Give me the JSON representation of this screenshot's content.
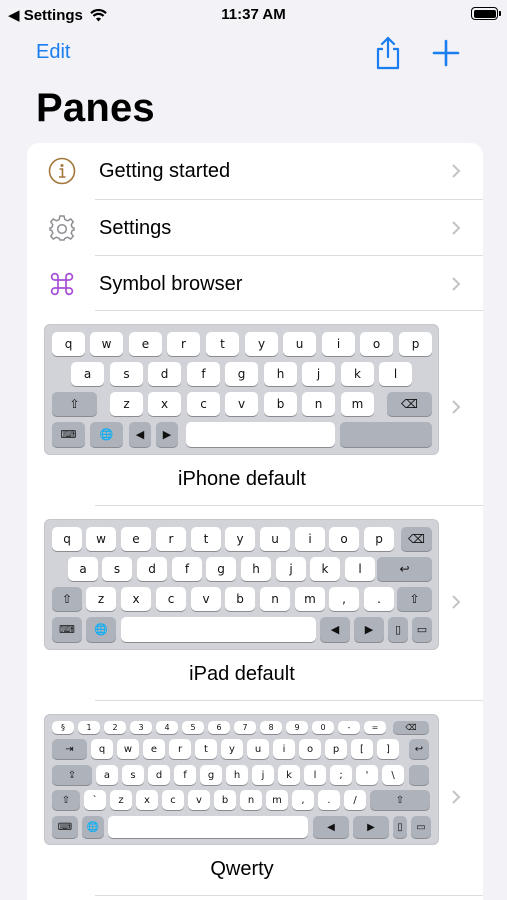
{
  "status": {
    "back_label": "◀ Settings",
    "time": "11:37 AM"
  },
  "nav": {
    "edit": "Edit",
    "share_icon": "share-icon",
    "add_icon": "plus-icon",
    "accent": "#1a7ef0"
  },
  "title": "Panes",
  "menu": [
    {
      "label": "Getting started",
      "icon": "info-icon",
      "color": "#a3773a"
    },
    {
      "label": "Settings",
      "icon": "gear-icon",
      "color": "#8e8e93"
    },
    {
      "label": "Symbol browser",
      "icon": "command-icon",
      "color": "#a64fd6"
    }
  ],
  "keyboards": [
    {
      "name": "iPhone default",
      "rows": [
        [
          "q",
          "w",
          "e",
          "r",
          "t",
          "y",
          "u",
          "i",
          "o",
          "p"
        ],
        [
          "a",
          "s",
          "d",
          "f",
          "g",
          "h",
          "j",
          "k",
          "l"
        ],
        [
          "⇧",
          "z",
          "x",
          "c",
          "v",
          "b",
          "n",
          "m",
          "⌫"
        ],
        [
          "⌨",
          "🌐",
          "◀",
          "▶",
          "",
          ""
        ]
      ]
    },
    {
      "name": "iPad default",
      "rows": [
        [
          "q",
          "w",
          "e",
          "r",
          "t",
          "y",
          "u",
          "i",
          "o",
          "p",
          "⌫"
        ],
        [
          "a",
          "s",
          "d",
          "f",
          "g",
          "h",
          "j",
          "k",
          "l",
          "↩"
        ],
        [
          "⇧",
          "z",
          "x",
          "c",
          "v",
          "b",
          "n",
          "m",
          ",",
          ".",
          "⇧"
        ],
        [
          "⌨",
          "🌐",
          "",
          "◀",
          "▶",
          "▯",
          "▭"
        ]
      ]
    },
    {
      "name": "Qwerty",
      "rows": [
        [
          "§",
          "1",
          "2",
          "3",
          "4",
          "5",
          "6",
          "7",
          "8",
          "9",
          "0",
          "-",
          "=",
          "⌫"
        ],
        [
          "⇥",
          "q",
          "w",
          "e",
          "r",
          "t",
          "y",
          "u",
          "i",
          "o",
          "p",
          "[",
          "]",
          "↩"
        ],
        [
          "⇪",
          "a",
          "s",
          "d",
          "f",
          "g",
          "h",
          "j",
          "k",
          "l",
          ";",
          "'",
          "\\",
          ""
        ],
        [
          "⇧",
          "`",
          "z",
          "x",
          "c",
          "v",
          "b",
          "n",
          "m",
          ",",
          ".",
          "/",
          "⇧"
        ],
        [
          "⌨",
          "🌐",
          "",
          "◀",
          "▶",
          "▯",
          "▭"
        ]
      ]
    }
  ]
}
